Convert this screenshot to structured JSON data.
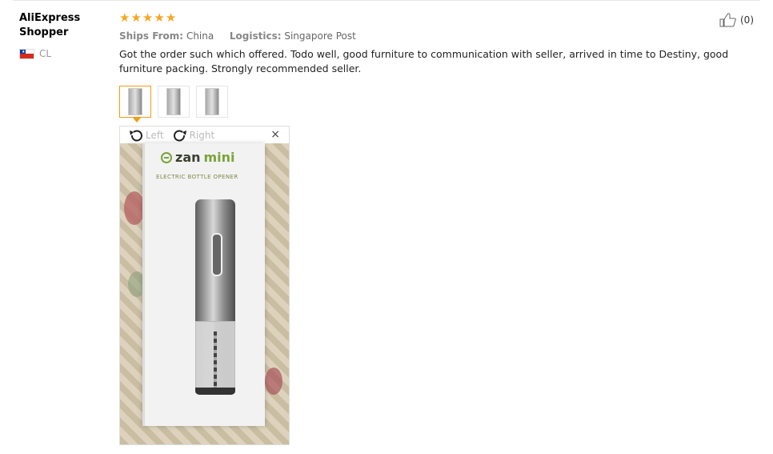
{
  "reviewer": {
    "name_line1": "AliExpress",
    "name_line2": "Shopper",
    "country_code": "CL"
  },
  "review": {
    "rating_stars": 5,
    "ships_from_label": "Ships From:",
    "ships_from_value": "China",
    "logistics_label": "Logistics:",
    "logistics_value": "Singapore Post",
    "text": "Got the order such which offered. Todo well, good furniture to communication with seller, arrived in time to Destiny, good furniture packing. Strongly recommended seller.",
    "helpful_count": "(0)"
  },
  "image_viewer": {
    "rotate_left_label": "Left",
    "rotate_right_label": "Right",
    "close_label": "×",
    "photo_brand_prefix": "zan",
    "photo_brand_suffix": "mini",
    "photo_subtitle": "ELECTRIC BOTTLE OPENER"
  },
  "colors": {
    "star": "#f5a623",
    "active_thumb": "#f39c12",
    "flag_red": "#d52b1e",
    "flag_blue": "#0039a6"
  },
  "icons": [
    "thumbs-up-icon",
    "rotate-left-icon",
    "rotate-right-icon",
    "close-icon",
    "flag-icon"
  ]
}
